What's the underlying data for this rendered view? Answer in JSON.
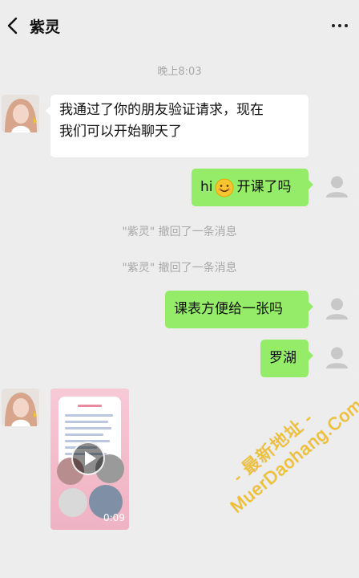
{
  "header": {
    "title": "紫灵"
  },
  "time": "晚上8:03",
  "messages": {
    "m1": "我通过了你的朋友验证请求，现在\n我们可以开始聊天了",
    "m2_pre": "hi",
    "m2_post": "开课了吗",
    "m3": "课表方便给一张吗",
    "m4": "罗湖"
  },
  "system": {
    "s1": "\"紫灵\" 撤回了一条消息",
    "s2": "\"紫灵\" 撤回了一条消息"
  },
  "video": {
    "duration": "0:09"
  },
  "watermark": {
    "line1": "- 最新地址 -",
    "line2": "MuerDaohang.Com"
  },
  "colors": {
    "background": "#ededed",
    "green_bubble": "#95ec69",
    "white_bubble": "#ffffff",
    "system_text": "#a8a8a8"
  },
  "icons": {
    "back": "chevron-left-icon",
    "more": "more-dots-icon",
    "play": "play-icon",
    "smiley": "smiley-emoji-icon",
    "self_avatar": "default-user-avatar-icon"
  }
}
